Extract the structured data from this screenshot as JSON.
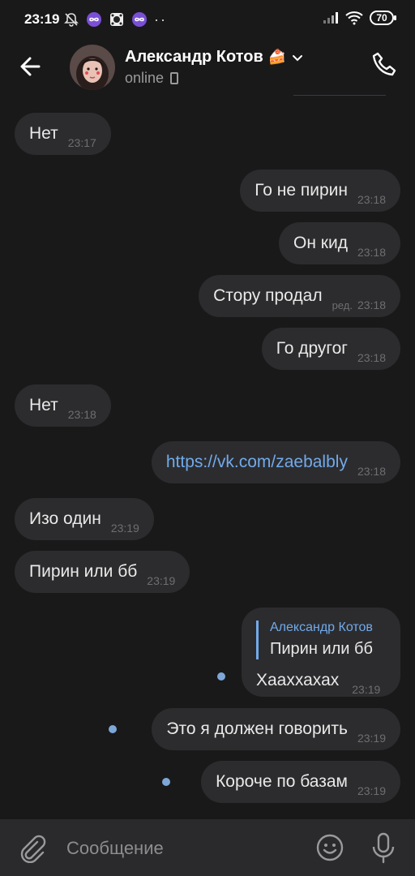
{
  "status_bar": {
    "time": "23:19",
    "battery": "70"
  },
  "header": {
    "contact_name": "Александр Котов",
    "contact_emoji": "🍰",
    "status": "online"
  },
  "messages": [
    {
      "direction": "in",
      "text": "Нет",
      "time": "23:17"
    },
    {
      "direction": "out",
      "text": "Го не пирин",
      "time": "23:18"
    },
    {
      "direction": "out",
      "text": "Он кид",
      "time": "23:18"
    },
    {
      "direction": "out",
      "text": "Стору продал",
      "edited": "ред.",
      "time": "23:18"
    },
    {
      "direction": "out",
      "text": "Го другог",
      "time": "23:18"
    },
    {
      "direction": "in",
      "text": "Нет",
      "time": "23:18"
    },
    {
      "direction": "out",
      "text": "https://vk.com/zaebalbly",
      "time": "23:18",
      "is_link": true
    },
    {
      "direction": "in",
      "text": "Изо один",
      "time": "23:19"
    },
    {
      "direction": "in",
      "text": "Пирин или бб",
      "time": "23:19"
    },
    {
      "direction": "out",
      "reply_author": "Александр Котов",
      "reply_text": "Пирин или бб",
      "text": "Хааххахах",
      "time": "23:19",
      "unread": true
    },
    {
      "direction": "out",
      "text": "Это я должен говорить",
      "time": "23:19",
      "unread": true
    },
    {
      "direction": "out",
      "text": "Короче по базам",
      "time": "23:19",
      "unread": true
    }
  ],
  "composer": {
    "placeholder": "Сообщение"
  },
  "colors": {
    "background": "#19191a",
    "bubble": "#2c2c2e",
    "link": "#71aaeb",
    "unread_dot": "#7ea7d8"
  }
}
